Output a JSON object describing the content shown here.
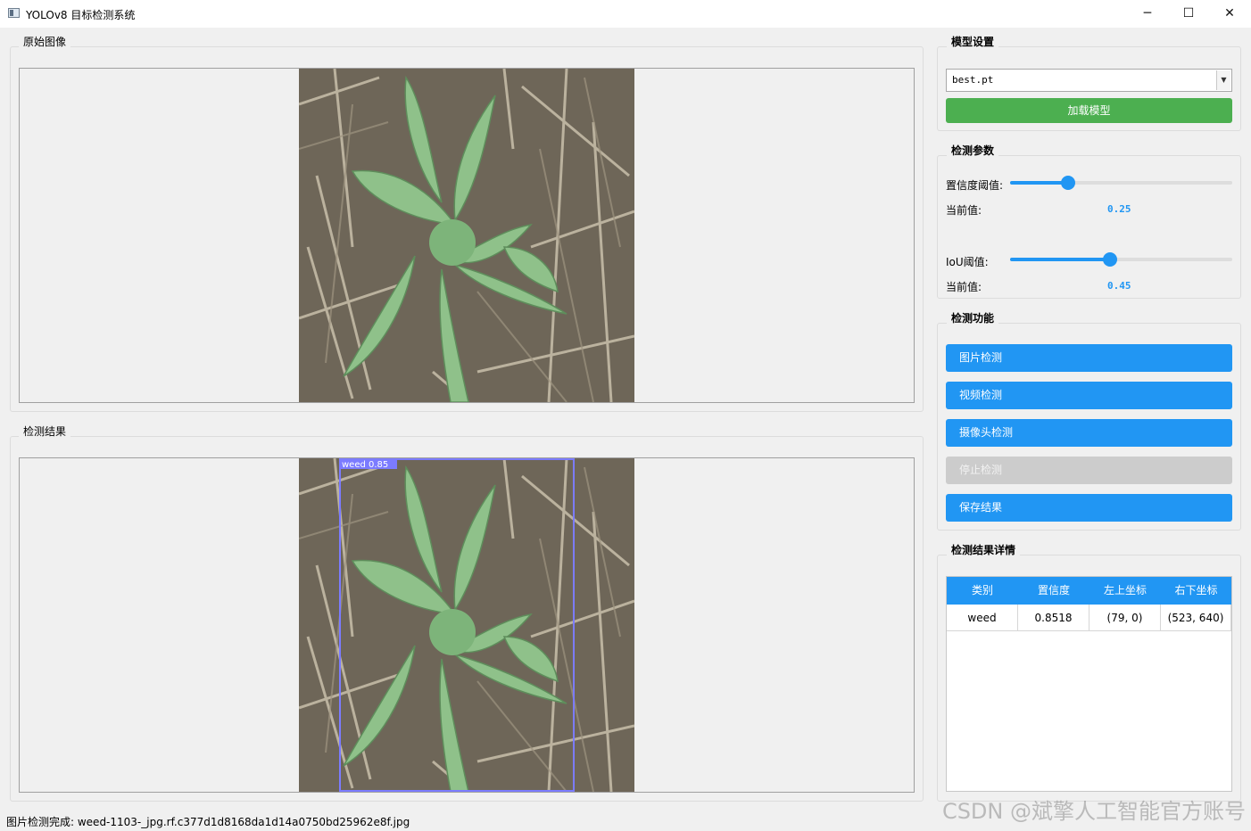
{
  "window": {
    "title": "YOLOv8 目标检测系统",
    "minimize_glyph": "─",
    "maximize_glyph": "☐",
    "close_glyph": "✕"
  },
  "original_panel": {
    "title": "原始图像"
  },
  "result_panel": {
    "title": "检测结果",
    "box_label": "weed 0.85",
    "box_color": "#7b7bff"
  },
  "model_settings": {
    "title": "模型设置",
    "model_selected": "best.pt",
    "load_button": "加载模型"
  },
  "detect_params": {
    "title": "检测参数",
    "confidence_label": "置信度阈值:",
    "confidence_current_label": "当前值:",
    "confidence_value": "0.25",
    "iou_label": "IoU阈值:",
    "iou_current_label": "当前值:",
    "iou_value": "0.45"
  },
  "slider_levels": {
    "confidence": 0.26,
    "iou": 0.45
  },
  "detect_functions": {
    "title": "检测功能",
    "image_detect": "图片检测",
    "video_detect": "视频检测",
    "camera_detect": "摄像头检测",
    "stop_detect": "停止检测",
    "save_result": "保存结果"
  },
  "results_details": {
    "title": "检测结果详情",
    "columns": [
      "类别",
      "置信度",
      "左上坐标",
      "右下坐标"
    ],
    "rows": [
      [
        "weed",
        "0.8518",
        "(79, 0)",
        "(523, 640)"
      ]
    ]
  },
  "status": {
    "message": "图片检测完成: weed-1103-_jpg.rf.c377d1d8168da1d14a0750bd25962e8f.jpg"
  },
  "watermark": "CSDN @斌擎人工智能官方账号",
  "colors": {
    "accent_blue": "#2196f3",
    "accent_green": "#4caf50",
    "disabled_gray": "#cccccc"
  }
}
